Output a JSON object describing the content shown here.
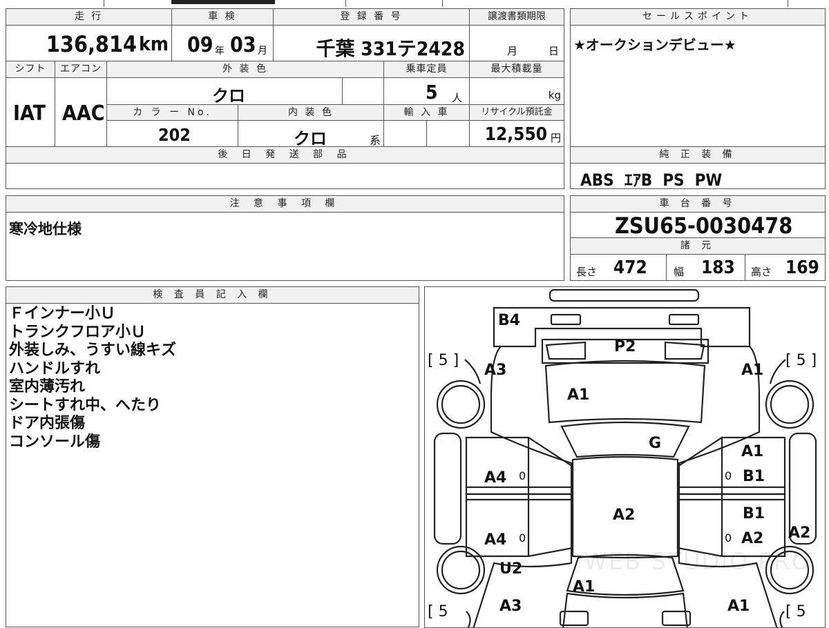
{
  "mileage": {
    "label": "走 行",
    "value": "136,814",
    "unit": "km"
  },
  "shaken": {
    "label": "車 検",
    "year": "09",
    "year_unit": "年",
    "month": "03",
    "month_unit": "月"
  },
  "registration": {
    "label": "登 録 番 号",
    "value": "千葉 331テ2428"
  },
  "transfer_deadline": {
    "label": "譲渡書類期限",
    "month_unit": "月",
    "day_unit": "日"
  },
  "sales_point": {
    "label": "セールスポイント",
    "text": "★オークションデビュー★"
  },
  "shift": {
    "label": "シフト",
    "value": "IAT"
  },
  "aircon": {
    "label": "エアコン",
    "value": "AAC"
  },
  "exterior_color": {
    "label": "外 装 色",
    "value": "クロ"
  },
  "capacity": {
    "label": "乗車定員",
    "value": "5",
    "unit": "人"
  },
  "max_load": {
    "label": "最大積載量",
    "unit": "kg"
  },
  "color_no": {
    "label": "カ ラ ー No.",
    "value": "202"
  },
  "interior_color": {
    "label": "内 装 色",
    "value": "クロ",
    "suffix": "系"
  },
  "import": {
    "label": "輸 入 車"
  },
  "recycle": {
    "label": "リサイクル預託金",
    "value": "12,550",
    "unit": "円"
  },
  "later_parts": {
    "label": "後 日 発 送 部 品"
  },
  "genuine_equipment": {
    "label": "純 正 装 備",
    "value": "ABS  ｴｱB  PS  PW"
  },
  "notes": {
    "label": "注 意 事 項 欄",
    "text": "寒冷地仕様"
  },
  "chassis": {
    "label": "車 台 番 号",
    "value": "ZSU65-0030478"
  },
  "specs": {
    "label": "諸 元",
    "length_label": "長さ",
    "length": "472",
    "width_label": "幅",
    "width": "183",
    "height_label": "高さ",
    "height": "169"
  },
  "inspector": {
    "label": "検 査 員 記 入 欄",
    "lines": [
      "Ｆインナー小Ｕ",
      "トランクフロア小Ｕ",
      "外装しみ、うすい線キズ",
      "ハンドルすれ",
      "室内薄汚れ",
      "シートすれ中、へたり",
      "ドア内張傷",
      "コンソール傷"
    ]
  },
  "diagram": {
    "tread_fl": "[ 5 ]",
    "tread_fr": "[ 5 ]",
    "tread_rl": "[ 5",
    "tread_rr": "[ 5",
    "labels": {
      "rear_bumper": "B4",
      "rear_panel": "P2",
      "left_quarter": "A3",
      "right_quarter": "A1",
      "trunk": "A1",
      "rear_glass": "G",
      "right_rear_door_a": "A1",
      "right_rear_door_b": "B1",
      "left_rear_door": "A4",
      "roof": "A2",
      "right_front_door_b": "B1",
      "right_front_door_a": "A2",
      "right_sill": "A2",
      "left_front_door": "A4",
      "left_fender_u": "U2",
      "hood": "A1",
      "left_fender": "A3",
      "right_fender": "A1"
    },
    "door_marks": {
      "left_rear": "0",
      "left_front": "0",
      "right_rear": "0",
      "right_front": "0"
    },
    "watermark": "WEB STUDIO PRO"
  }
}
